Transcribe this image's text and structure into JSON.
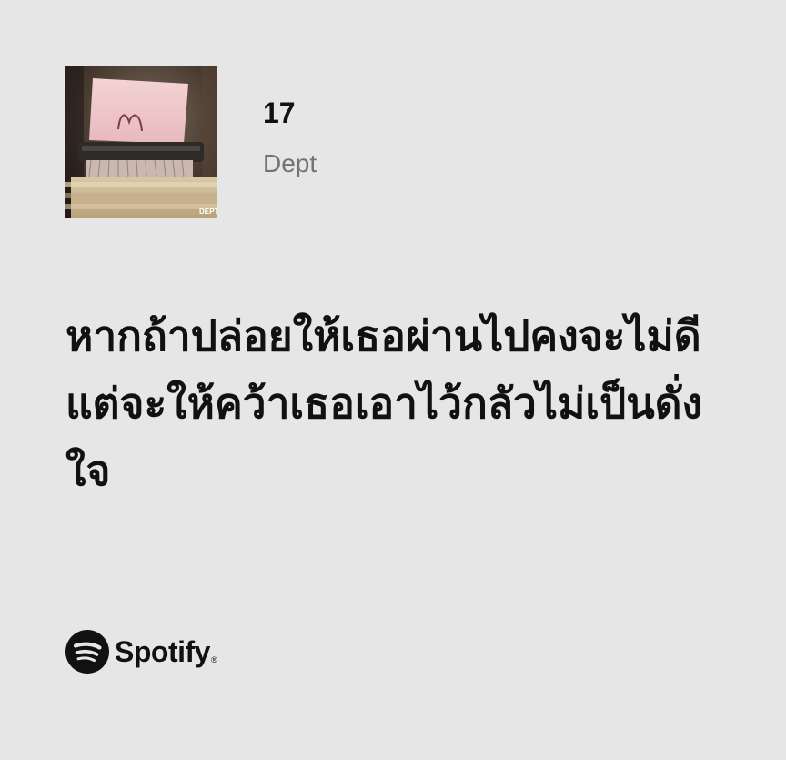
{
  "track": {
    "title": "17",
    "artist": "Dept"
  },
  "cover": {
    "label": "DEPT",
    "icon": "album-cover-image"
  },
  "lyrics": {
    "lines": [
      "หากถ้าปล่อยให้เธอผ่านไปคงจะไม่ดี",
      "แต่จะให้คว้าเธอเอาไว้กลัวไม่เป็นดั่งใจ"
    ]
  },
  "brand": {
    "name": "Spotify",
    "registered": "®",
    "icon": "spotify-logo-icon"
  },
  "colors": {
    "background": "#e6e6e6",
    "text": "#111111",
    "artist_text": "#737373"
  }
}
